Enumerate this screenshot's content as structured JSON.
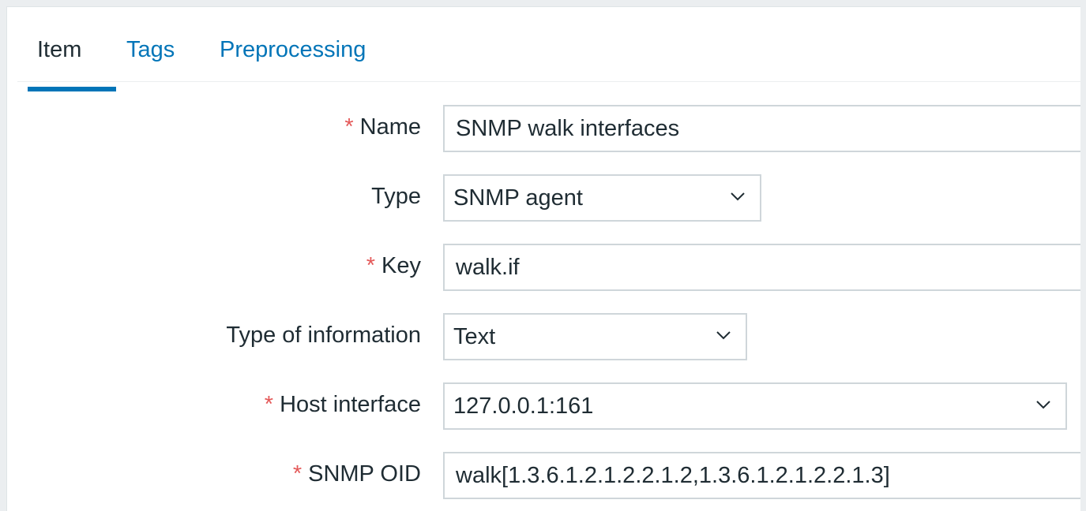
{
  "tabs": [
    {
      "label": "Item",
      "active": true
    },
    {
      "label": "Tags",
      "active": false
    },
    {
      "label": "Preprocessing",
      "active": false
    }
  ],
  "required_marker": "*",
  "form": {
    "name": {
      "label": "Name",
      "required": true,
      "value": "SNMP walk interfaces"
    },
    "type": {
      "label": "Type",
      "required": false,
      "value": "SNMP agent"
    },
    "key": {
      "label": "Key",
      "required": true,
      "value": "walk.if"
    },
    "type_of_information": {
      "label": "Type of information",
      "required": false,
      "value": "Text"
    },
    "host_interface": {
      "label": "Host interface",
      "required": true,
      "value": "127.0.0.1:161"
    },
    "snmp_oid": {
      "label": "SNMP OID",
      "required": true,
      "value": "walk[1.3.6.1.2.1.2.2.1.2,1.3.6.1.2.1.2.2.1.3]"
    }
  },
  "icons": {
    "dropdown": "chevron-down-icon"
  },
  "colors": {
    "link": "#0275b8",
    "required": "#e45959",
    "border": "#cfd6da",
    "background": "#ebeef0"
  }
}
